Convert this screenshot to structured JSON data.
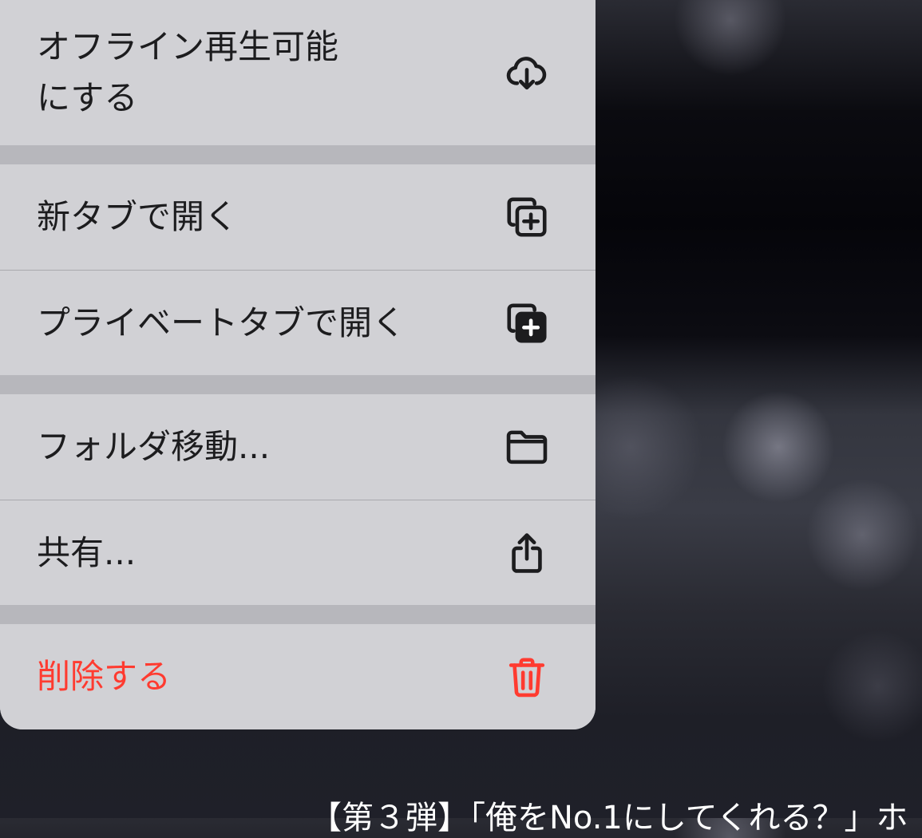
{
  "menu": {
    "items": [
      {
        "label": "オフライン再生可能\nにする",
        "icon": "cloud-download-icon"
      },
      {
        "label": "新タブで開く",
        "icon": "new-tab-icon"
      },
      {
        "label": "プライベートタブで開く",
        "icon": "private-tab-icon"
      },
      {
        "label": "フォルダ移動...",
        "icon": "folder-icon"
      },
      {
        "label": "共有...",
        "icon": "share-icon"
      },
      {
        "label": "削除する",
        "icon": "trash-icon"
      }
    ],
    "destructive_color": "#ff3b30"
  },
  "background": {
    "title": "【第３弾】「俺をNo.1にしてくれる？」ホ"
  }
}
